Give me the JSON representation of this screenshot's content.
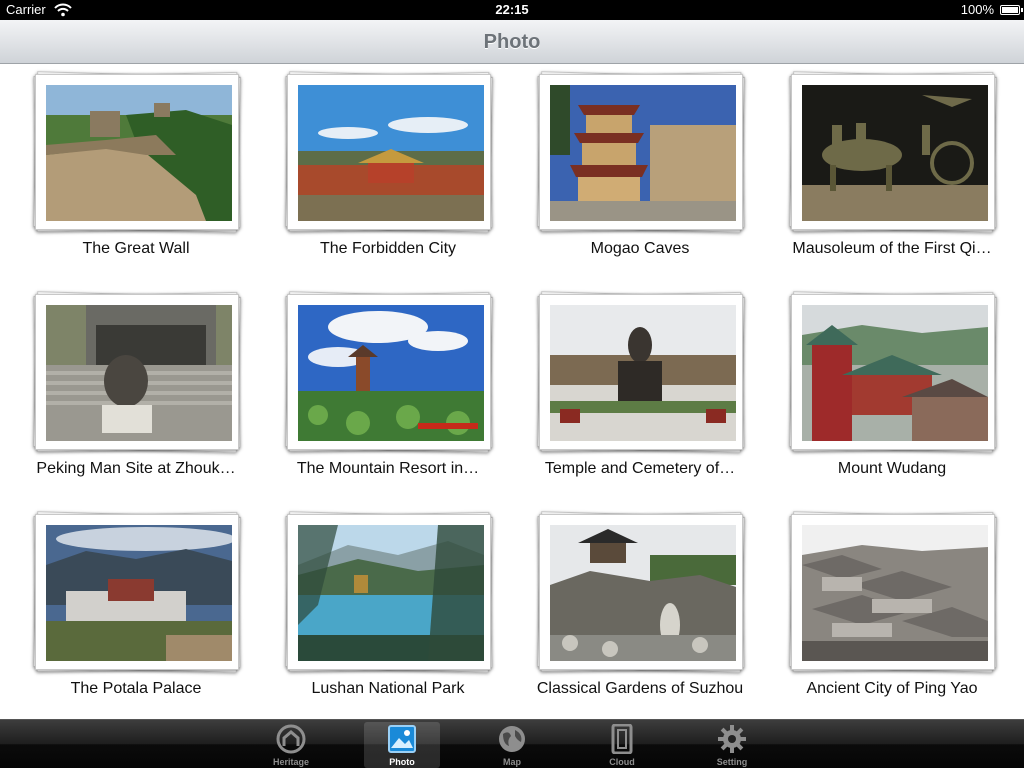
{
  "status_bar": {
    "carrier": "Carrier",
    "time": "22:15",
    "battery": "100%"
  },
  "nav": {
    "title": "Photo"
  },
  "photos": [
    {
      "caption": "The Great Wall"
    },
    {
      "caption": "The Forbidden City"
    },
    {
      "caption": "Mogao Caves"
    },
    {
      "caption": "Mausoleum of the First Qi…"
    },
    {
      "caption": "Peking Man Site at Zhouk…"
    },
    {
      "caption": "The Mountain Resort in…"
    },
    {
      "caption": "Temple and Cemetery of…"
    },
    {
      "caption": "Mount Wudang"
    },
    {
      "caption": "The Potala Palace"
    },
    {
      "caption": "Lushan National Park"
    },
    {
      "caption": "Classical Gardens of Suzhou"
    },
    {
      "caption": "Ancient City of Ping Yao"
    }
  ],
  "tabs": [
    {
      "label": "Heritage",
      "icon": "heritage-icon",
      "active": false
    },
    {
      "label": "Photo",
      "icon": "photo-icon",
      "active": true
    },
    {
      "label": "Map",
      "icon": "globe-icon",
      "active": false
    },
    {
      "label": "Cloud",
      "icon": "cloud-icon",
      "active": false
    },
    {
      "label": "Setting",
      "icon": "gear-icon",
      "active": false
    }
  ],
  "colors": {
    "nav_title": "#6d7379",
    "tabbar_bg": "#1e1e1e",
    "tab_active": "#ffffff",
    "tab_inactive": "#8e8e8e"
  }
}
